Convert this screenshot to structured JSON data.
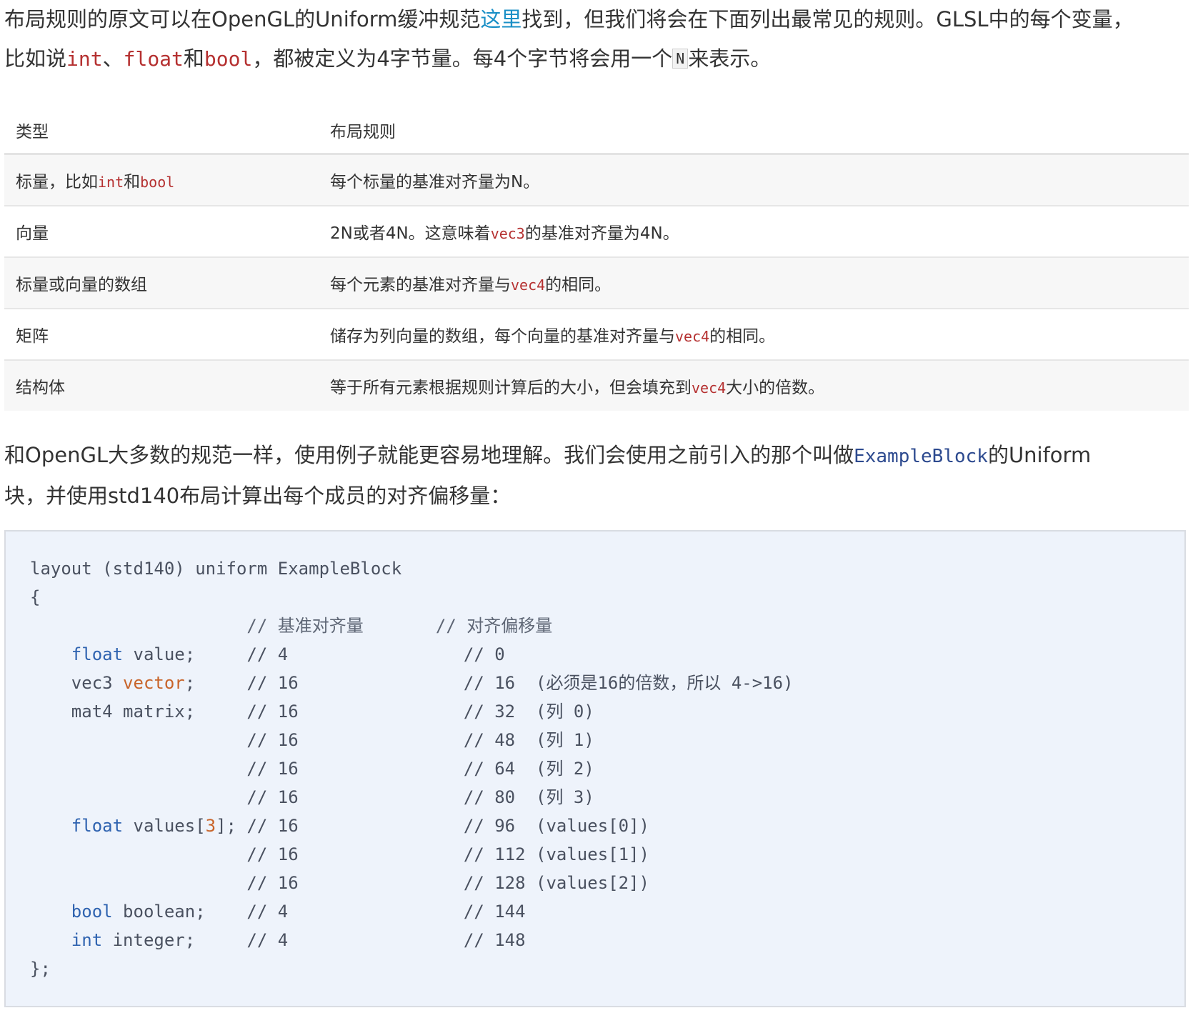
{
  "intro": {
    "line1_a": "布局规则的原文可以在OpenGL的Uniform缓冲规范",
    "line1_link": "这里",
    "line1_b": "找到，但我们将会在下面列出最常见的规则。GLSL中的每个变量，",
    "line2_a": "比如说",
    "code_int": "int",
    "sep1": "、",
    "code_float": "float",
    "sep2": "和",
    "code_bool": "bool",
    "line2_b": "，都被定义为4字节量。每4个字节将会用一个",
    "code_N": "N",
    "line2_c": "来表示。"
  },
  "table": {
    "headers": [
      "类型",
      "布局规则"
    ],
    "rows": [
      {
        "type_a": "标量，比如",
        "type_code1": "int",
        "type_b": "和",
        "type_code2": "bool",
        "rule_a": "每个标量的基准对齐量为N。"
      },
      {
        "type_a": "向量",
        "rule_a": "2N或者4N。这意味着",
        "rule_code": "vec3",
        "rule_b": "的基准对齐量为4N。"
      },
      {
        "type_a": "标量或向量的数组",
        "rule_a": "每个元素的基准对齐量与",
        "rule_code": "vec4",
        "rule_b": "的相同。"
      },
      {
        "type_a": "矩阵",
        "rule_a": "储存为列向量的数组，每个向量的基准对齐量与",
        "rule_code": "vec4",
        "rule_b": "的相同。"
      },
      {
        "type_a": "结构体",
        "rule_a": "等于所有元素根据规则计算后的大小，但会填充到",
        "rule_code": "vec4",
        "rule_b": "大小的倍数。"
      }
    ]
  },
  "para2": {
    "line1_a": "和OpenGL大多数的规范一样，使用例子就能更容易地理解。我们会使用之前引入的那个叫做",
    "line1_code": "ExampleBlock",
    "line1_b": "的Uniform",
    "line2": "块，并使用std140布局计算出每个成员的对齐偏移量："
  },
  "code": {
    "l1": "layout (std140) uniform ExampleBlock",
    "l2": "{",
    "l3": "                     // 基准对齐量       // 对齐偏移量",
    "l4_kw": "float",
    "l4_rest": " value;     // 4                 // 0",
    "l5_a": "    vec3 ",
    "l5_var": "vector",
    "l5_rest": ";     // 16                // 16  (必须是16的倍数，所以 4->16)",
    "l6": "    mat4 matrix;     // 16                // 32  (列 0)",
    "l7": "                     // 16                // 48  (列 1)",
    "l8": "                     // 16                // 64  (列 2)",
    "l9": "                     // 16                // 80  (列 3)",
    "l10_kw": "float",
    "l10_a": " values[",
    "l10_num": "3",
    "l10_rest": "]; // 16                // 96  (values[0])",
    "l11": "                     // 16                // 112 (values[1])",
    "l12": "                     // 16                // 128 (values[2])",
    "l13_kw": "bool",
    "l13_rest": " boolean;    // 4                 // 144",
    "l14_kw": "int",
    "l14_rest": " integer;     // 4                 // 148",
    "l15": "};"
  },
  "colors": {
    "inline_code": "#b53030",
    "link": "#1a8fc6",
    "keyword": "#2f63b0",
    "highlight": "#c8642a",
    "code_bg": "#eef3fb"
  }
}
